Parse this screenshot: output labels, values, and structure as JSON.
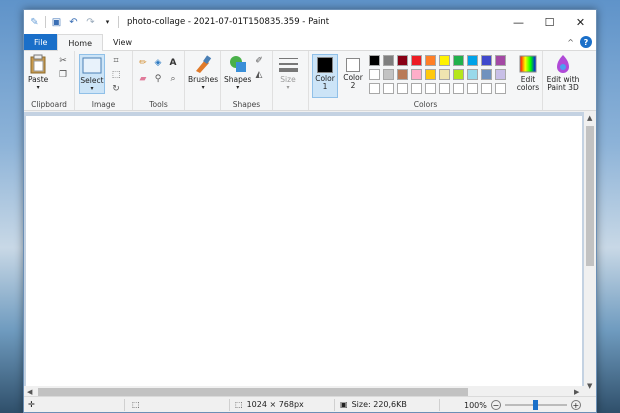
{
  "window": {
    "title": "photo-collage - 2021-07-01T150835.359 - Paint"
  },
  "window_controls": {
    "minimize": "—",
    "maximize": "☐",
    "close": "✕"
  },
  "qat_icons": [
    "paint-app-icon",
    "save-icon",
    "undo-icon",
    "redo-icon",
    "customize-qat-icon"
  ],
  "tabs": [
    {
      "label": "File"
    },
    {
      "label": "Home"
    },
    {
      "label": "View"
    }
  ],
  "help": {
    "label": "?"
  },
  "ribbon": {
    "clipboard": {
      "label": "Clipboard",
      "paste": "Paste"
    },
    "image": {
      "label": "Image",
      "select": "Select"
    },
    "tools": {
      "label": "Tools"
    },
    "brushes": {
      "label": "Brushes"
    },
    "shapes": {
      "label": "Shapes",
      "shapes_btn": "Shapes"
    },
    "size": {
      "label": "Size"
    },
    "colors": {
      "label": "Colors",
      "color1": "Color\n1",
      "color2": "Color\n2",
      "edit_colors": "Edit\ncolors",
      "palette": [
        [
          "#000000",
          "#7f7f7f",
          "#880015",
          "#ed1c24",
          "#ff7f27",
          "#fff200",
          "#22b14c",
          "#00a2e8",
          "#3f48cc",
          "#a349a4"
        ],
        [
          "#ffffff",
          "#c3c3c3",
          "#b97a57",
          "#ffaec9",
          "#ffc90e",
          "#efe4b0",
          "#b5e61d",
          "#99d9ea",
          "#7092be",
          "#c8bfe7"
        ],
        [
          "#ffffff",
          "#ffffff",
          "#ffffff",
          "#ffffff",
          "#ffffff",
          "#ffffff",
          "#ffffff",
          "#ffffff",
          "#ffffff",
          "#ffffff"
        ]
      ]
    },
    "paint3d": {
      "label": "Edit with\nPaint 3D"
    }
  },
  "status": {
    "dimensions": "1024 × 768px",
    "size": "Size: 220,6KB",
    "zoom": "100%",
    "zoom_fraction": 0.5
  }
}
